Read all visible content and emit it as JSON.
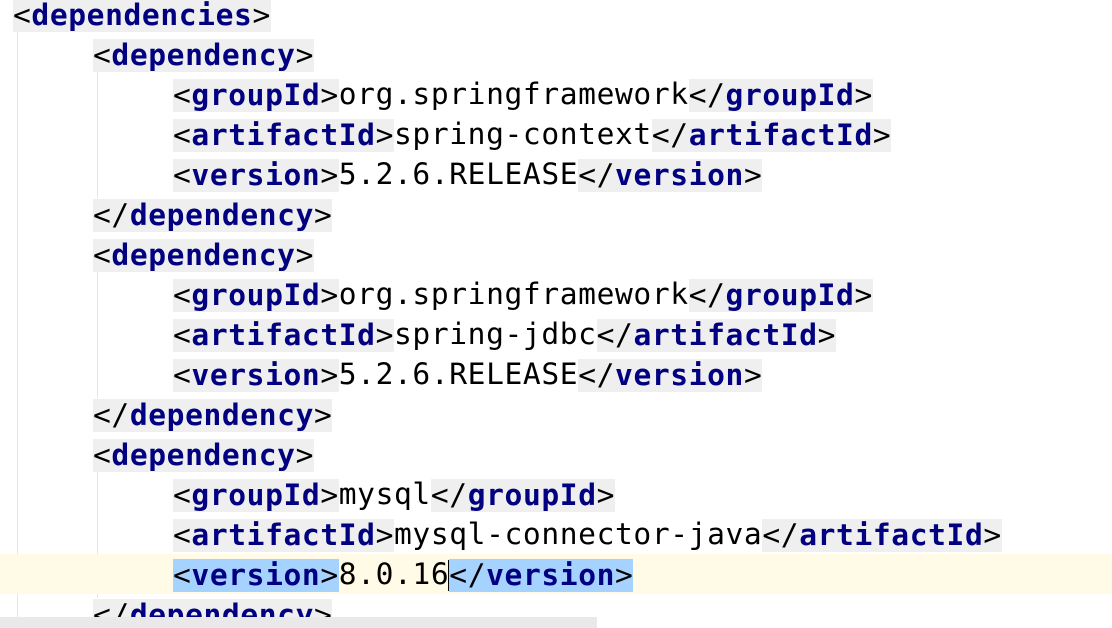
{
  "editor": {
    "language": "XML",
    "caret": {
      "line": 14,
      "after_text": "8.0.16"
    },
    "selection_color": "#a6d2ff",
    "tag_color": "#000080",
    "tag_background": "#efefef",
    "current_line_color": "#fffbe6",
    "lines": [
      {
        "indent": 0,
        "kind": "open",
        "tag": "dependencies"
      },
      {
        "indent": 1,
        "kind": "open",
        "tag": "dependency"
      },
      {
        "indent": 2,
        "kind": "element",
        "tag": "groupId",
        "text": "org.springframework"
      },
      {
        "indent": 2,
        "kind": "element",
        "tag": "artifactId",
        "text": "spring-context"
      },
      {
        "indent": 2,
        "kind": "element",
        "tag": "version",
        "text": "5.2.6.RELEASE"
      },
      {
        "indent": 1,
        "kind": "close",
        "tag": "dependency"
      },
      {
        "indent": 1,
        "kind": "open",
        "tag": "dependency"
      },
      {
        "indent": 2,
        "kind": "element",
        "tag": "groupId",
        "text": "org.springframework"
      },
      {
        "indent": 2,
        "kind": "element",
        "tag": "artifactId",
        "text": "spring-jdbc"
      },
      {
        "indent": 2,
        "kind": "element",
        "tag": "version",
        "text": "5.2.6.RELEASE"
      },
      {
        "indent": 1,
        "kind": "close",
        "tag": "dependency"
      },
      {
        "indent": 1,
        "kind": "open",
        "tag": "dependency"
      },
      {
        "indent": 2,
        "kind": "element",
        "tag": "groupId",
        "text": "mysql"
      },
      {
        "indent": 2,
        "kind": "element",
        "tag": "artifactId",
        "text": "mysql-connector-java"
      },
      {
        "indent": 2,
        "kind": "element",
        "tag": "version",
        "text": "8.0.16",
        "current": true,
        "selected": true
      },
      {
        "indent": 1,
        "kind": "close",
        "tag": "dependency"
      }
    ]
  }
}
